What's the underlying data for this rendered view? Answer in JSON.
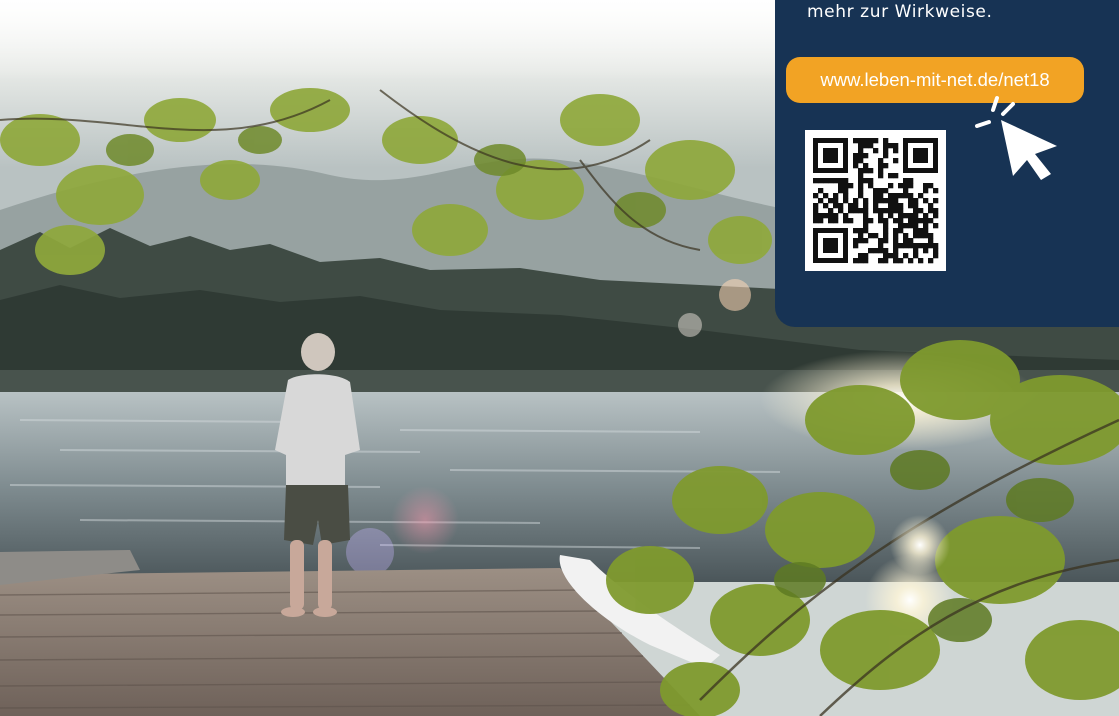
{
  "card": {
    "text_line": "mehr zur Wirkweise.",
    "url": "www.leben-mit-net.de/net18",
    "qr_icon": "qr-code-icon",
    "cursor_icon": "mouse-pointer-icon"
  },
  "colors": {
    "card_background": "#173354",
    "url_pill": "#f2a324",
    "text": "#ffffff"
  }
}
